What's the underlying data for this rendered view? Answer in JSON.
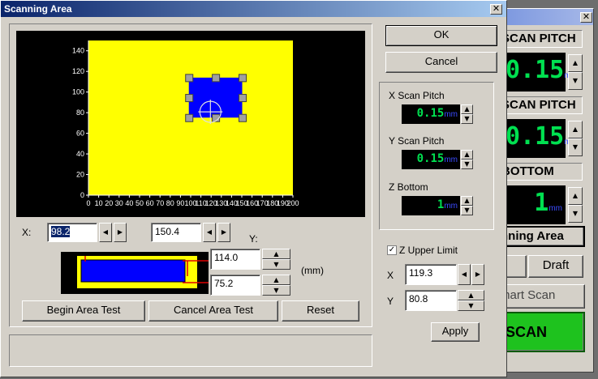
{
  "dialog": {
    "title": "Scanning Area",
    "close_glyph": "✕",
    "buttons": {
      "ok": "OK",
      "cancel": "Cancel",
      "apply": "Apply",
      "begin_area_test": "Begin Area Test",
      "cancel_area_test": "Cancel Area Test",
      "reset": "Reset"
    },
    "x_label": "X:",
    "x_value": "98.2",
    "x2_value": "150.4",
    "y_label": "Y:",
    "y1_value": "114.0",
    "y2_value": "75.2",
    "units_label": "(mm)",
    "scan_pitch": {
      "x_label": "X Scan Pitch",
      "x_value": "0.15",
      "y_label": "Y Scan Pitch",
      "y_value": "0.15",
      "z_label": "Z Bottom",
      "z_value": "1",
      "unit": "mm"
    },
    "z_upper": {
      "checkbox_label": "Z Upper Limit",
      "checked": true,
      "check_glyph": "✓",
      "x_label": "X",
      "x_value": "119.3",
      "y_label": "Y",
      "y_value": "80.8"
    },
    "arrows": {
      "left": "◀",
      "right": "▶",
      "up": "▲",
      "down": "▼"
    }
  },
  "background_window": {
    "close_glyph": "✕",
    "x_pitch_header": "SCAN PITCH",
    "x_pitch_value": "0.15",
    "y_pitch_header": "SCAN PITCH",
    "y_pitch_value": "0.15",
    "bottom_header": "BOTTOM",
    "bottom_value": "1",
    "unit": "mm",
    "scanning_area_button": "nning Area",
    "mode_left": "e",
    "mode_draft": "Draft",
    "smart_scan": "mart Scan",
    "scan_button": "SCAN"
  },
  "chart_data": {
    "type": "area",
    "x_ticks": [
      0,
      10,
      20,
      30,
      40,
      50,
      60,
      70,
      80,
      90,
      100,
      110,
      120,
      130,
      140,
      150,
      160,
      170,
      180,
      190,
      200
    ],
    "y_ticks": [
      0,
      20,
      40,
      60,
      80,
      100,
      120,
      140
    ],
    "xlim": [
      0,
      200
    ],
    "ylim": [
      0,
      150
    ],
    "background_color": "#000000",
    "area_color": "#ffff00",
    "selection": {
      "x_min": 98.2,
      "x_max": 150.4,
      "y_min": 75.2,
      "y_max": 114.0,
      "color": "#0000ff"
    },
    "z_upper_point": {
      "x": 119.3,
      "y": 80.8
    }
  }
}
